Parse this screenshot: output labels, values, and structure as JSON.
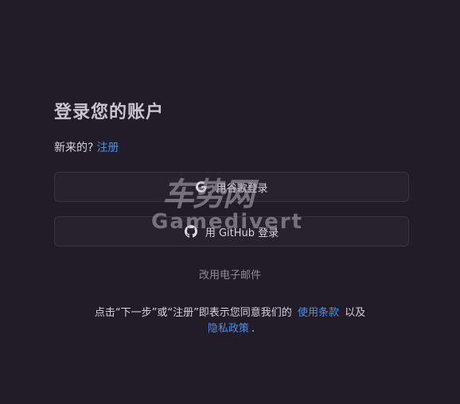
{
  "heading": "登录您的账户",
  "signup_prompt": {
    "text": "新来的?",
    "link": "注册"
  },
  "buttons": {
    "google": {
      "label": "用谷歌登录",
      "icon": "google-icon"
    },
    "github": {
      "label": "用 GitHub 登录",
      "icon": "github-icon"
    }
  },
  "email_option": "改用电子邮件",
  "terms": {
    "prefix": "点击“下一步”或“注册”即表示您同意我们的",
    "terms_link": "使用条款",
    "middle": "以及",
    "privacy_link": "隐私政策",
    "suffix": "."
  },
  "watermark": {
    "top_text": "车势网",
    "bottom_text": "Gamedivert"
  },
  "colors": {
    "background": "#221c29",
    "link": "#4a8fe8",
    "button_bg": "#28222f",
    "button_border": "#3b3442"
  }
}
